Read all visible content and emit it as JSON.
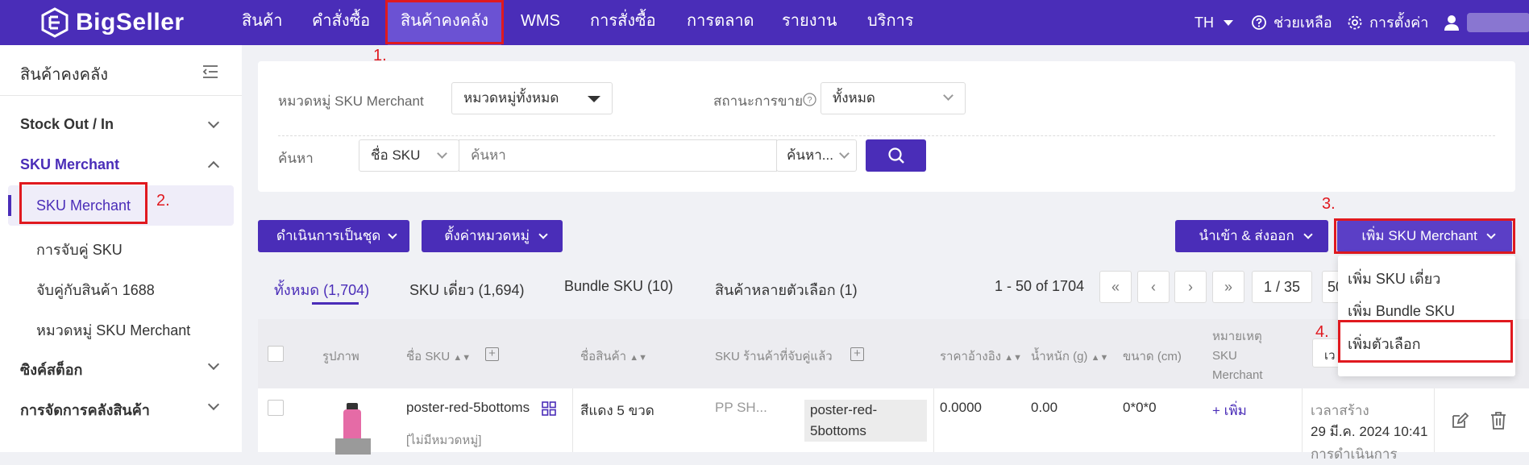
{
  "header": {
    "brand": "BigSeller",
    "nav": [
      "สินค้า",
      "คำสั่งซื้อ",
      "สินค้าคงคลัง",
      "WMS",
      "การสั่งซื้อ",
      "การตลาด",
      "รายงาน",
      "บริการ"
    ],
    "language": "TH",
    "help": "ช่วยเหลือ",
    "settings": "การตั้งค่า"
  },
  "annotations": [
    "1.",
    "2.",
    "3.",
    "4."
  ],
  "sidebar": {
    "title": "สินค้าคงคลัง",
    "groups": {
      "stock": "Stock Out / In",
      "sku_merchant": "SKU Merchant",
      "sync": "ซิงค์สต็อก",
      "warehouse": "การจัดการคลังสินค้า"
    },
    "items": [
      "SKU Merchant",
      "การจับคู่ SKU",
      "จับคู่กับสินค้า 1688",
      "หมวดหมู่ SKU Merchant"
    ]
  },
  "filters": {
    "category_label": "หมวดหมู่ SKU Merchant",
    "category_value": "หมวดหมู่ทั้งหมด",
    "status_label": "สถานะการขาย",
    "status_value": "ทั้งหมด",
    "search_label": "ค้นหา",
    "search_field": "ชื่อ SKU",
    "search_placeholder": "ค้นหา",
    "search_mode": "ค้นหา..."
  },
  "toolbar": {
    "bulk": "ดำเนินการเป็นชุด",
    "set_category": "ตั้งค่าหมวดหมู่",
    "import_export": "นำเข้า & ส่งออก",
    "add_sku": "เพิ่ม SKU Merchant"
  },
  "dropdown": [
    "เพิ่ม SKU เดี่ยว",
    "เพิ่ม Bundle SKU",
    "เพิ่มตัวเลือก"
  ],
  "tabs": [
    "ทั้งหมด (1,704)",
    "SKU เดี่ยว (1,694)",
    "Bundle SKU (10)",
    "สินค้าหลายตัวเลือก (1)"
  ],
  "pagination": {
    "range": "1 - 50 of 1704",
    "page": "1 / 35",
    "size": "50"
  },
  "table": {
    "headers": {
      "image": "รูปภาพ",
      "sku_name": "ชื่อ SKU",
      "product_name": "ชื่อสินค้า",
      "store_sku": "SKU ร้านค้าที่จับคู่แล้ว",
      "ref_price": "ราคาอ้างอิง",
      "weight": "น้ำหนัก (g)",
      "size": "ขนาด (cm)",
      "note_1": "หมายเหตุ",
      "note_2": "SKU",
      "note_3": "Merchant",
      "time_select": "เว"
    },
    "row": {
      "sku_name": "poster-red-5bottoms",
      "no_category": "[ไม่มีหมวดหมู่]",
      "product_name": "สีแดง 5 ขวด",
      "store": "PP SH...",
      "store_sku_1": "poster-red-",
      "store_sku_2": "5bottoms",
      "price": "0.0000",
      "weight": "0.00",
      "size": "0*0*0",
      "add_note": "+ เพิ่ม",
      "created_label": "เวลาสร้าง",
      "created_time": "29 มี.ค. 2024 10:41",
      "operator": "การดำเนินการ"
    }
  },
  "colors": {
    "primary": "#4a2db8",
    "annotation": "#e0191f"
  }
}
